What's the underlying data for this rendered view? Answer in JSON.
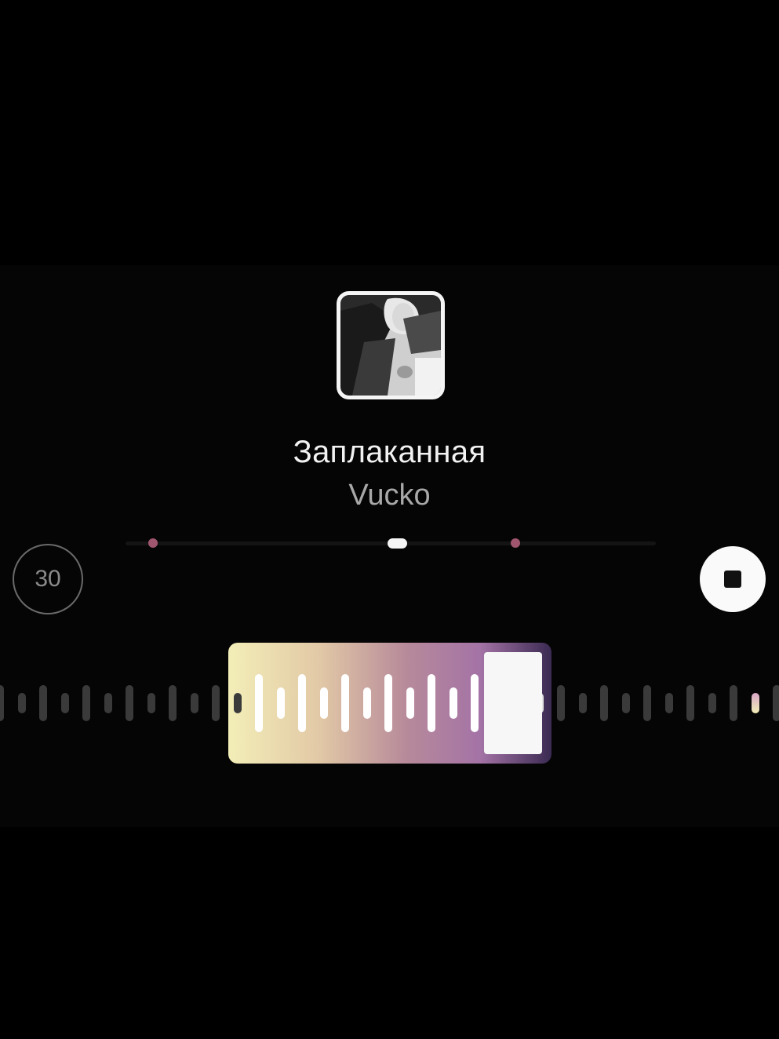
{
  "track": {
    "title": "Заплаканная",
    "artist": "Vucko"
  },
  "controls": {
    "duration_label": "30",
    "stop_icon": "stop-icon"
  },
  "scrubber": {
    "position": 0.51,
    "markers": [
      0.05,
      0.73
    ]
  },
  "colors": {
    "background": "#000000",
    "marker": "#a0566e",
    "gradient_start": "#f3eeb8",
    "gradient_mid": "#b78a9a",
    "gradient_end": "#3a2a52"
  },
  "icons": {
    "album_art": "album-art-image",
    "stop": "stop-icon"
  }
}
